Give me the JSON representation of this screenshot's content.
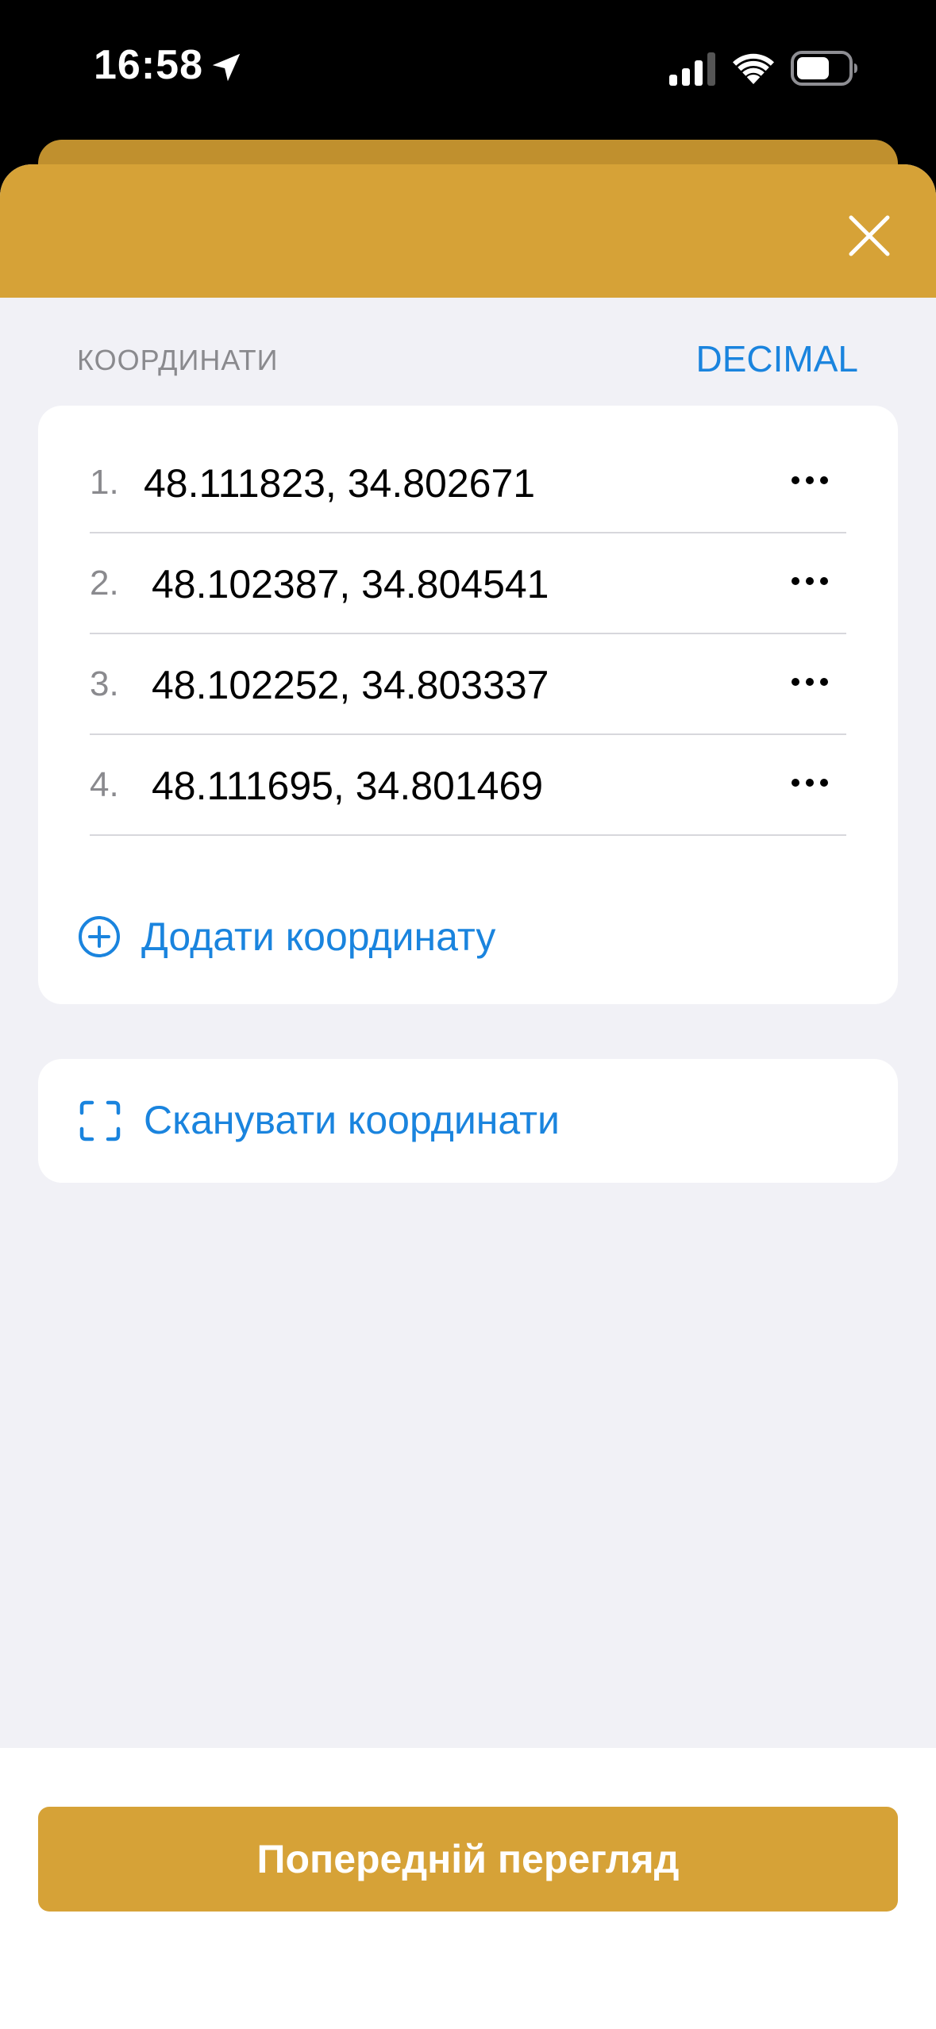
{
  "status_bar": {
    "time": "16:58",
    "icons": [
      "location-arrow-icon",
      "cellular-signal-icon",
      "wifi-icon",
      "battery-icon"
    ]
  },
  "colors": {
    "accent_gold": "#d6a237",
    "link_blue": "#1a84de",
    "background": "#f1f1f6"
  },
  "header": {
    "close_icon": "close-icon"
  },
  "coordinates": {
    "section_title": "КООРДИНАТИ",
    "format_label": "DECIMAL",
    "items": [
      {
        "index": "1.",
        "value": "48.111823, 34.802671"
      },
      {
        "index": "2.",
        "value": "48.102387, 34.804541"
      },
      {
        "index": "3.",
        "value": "48.102252, 34.803337"
      },
      {
        "index": "4.",
        "value": "48.111695, 34.801469"
      }
    ],
    "add_label": "Додати координату"
  },
  "scan": {
    "label": "Сканувати координати"
  },
  "footer": {
    "preview_label": "Попередній перегляд"
  }
}
